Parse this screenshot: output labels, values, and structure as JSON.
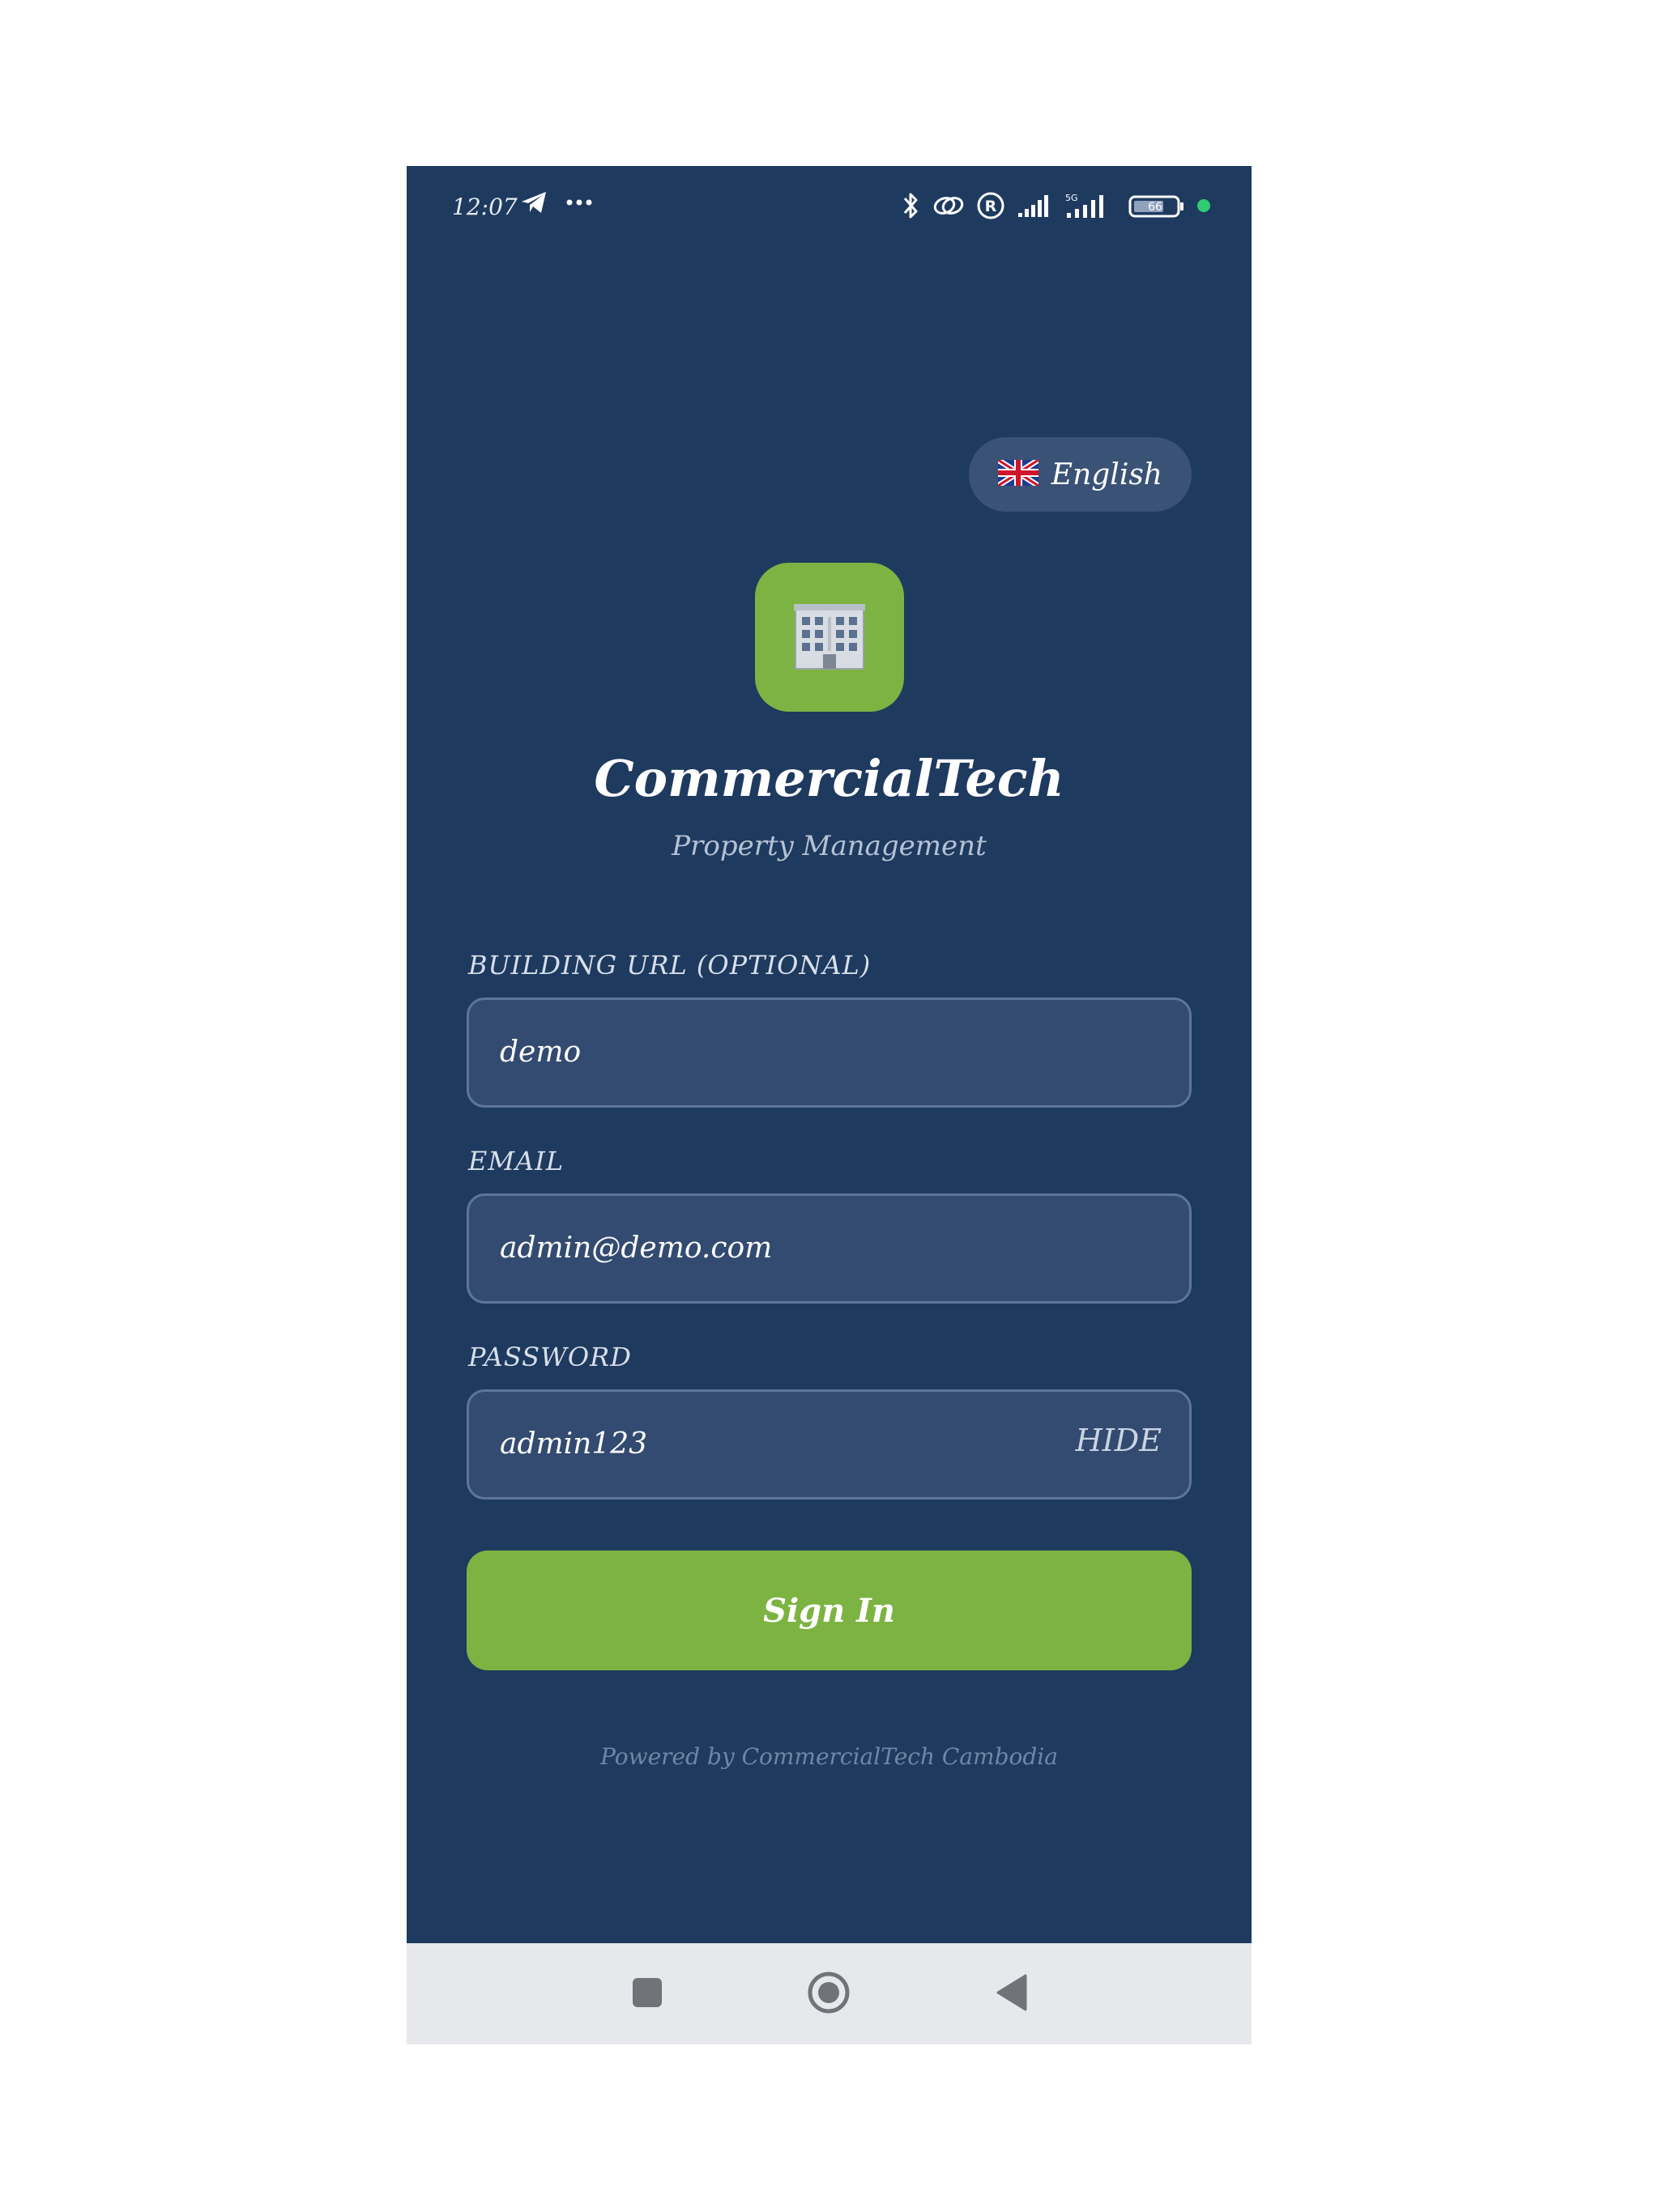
{
  "status_bar": {
    "time": "12:07",
    "battery_level": "66",
    "network_label": "5G"
  },
  "language": {
    "flag_icon": "uk-flag-icon",
    "label": "English"
  },
  "brand": {
    "logo_icon": "office-building-icon",
    "title": "CommercialTech",
    "subtitle": "Property Management"
  },
  "form": {
    "building_url": {
      "label": "BUILDING URL (OPTIONAL)",
      "value": "demo"
    },
    "email": {
      "label": "EMAIL",
      "value": "admin@demo.com"
    },
    "password": {
      "label": "PASSWORD",
      "value": "admin123",
      "toggle_label": "HIDE"
    },
    "submit_label": "Sign In"
  },
  "footer": {
    "text": "Powered by CommercialTech Cambodia"
  },
  "colors": {
    "background": "#1f3a5f",
    "accent": "#7cb342",
    "input_bg": "#334b70",
    "nav_bar": "#e6e8ec"
  },
  "nav_bar": {
    "recents_icon": "square-icon",
    "home_icon": "circle-home-icon",
    "back_icon": "triangle-back-icon"
  }
}
